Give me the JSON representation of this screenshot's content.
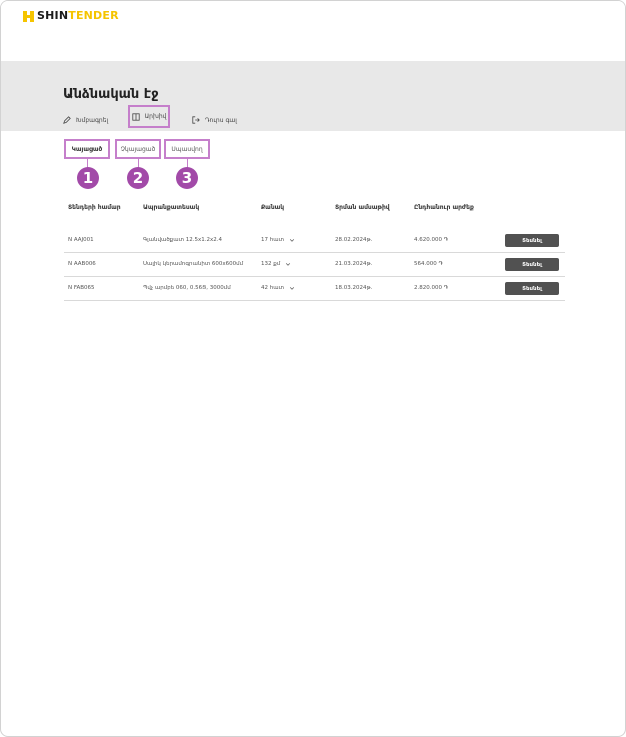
{
  "app": {
    "logo_part1": "SHIN",
    "logo_part2": "TENDER",
    "brand_color": "#f5c400"
  },
  "page": {
    "title": "Անձնական էջ"
  },
  "tabs": [
    {
      "label": "Խմբագրել",
      "icon": "pencil-icon"
    },
    {
      "label": "Արխիվ",
      "icon": "archive-icon"
    },
    {
      "label": "Դուրս գալ",
      "icon": "logout-icon"
    }
  ],
  "subtabs": [
    {
      "label": "Կայացած"
    },
    {
      "label": "Չկայացած"
    },
    {
      "label": "Սպասվող"
    }
  ],
  "markers": [
    "1",
    "2",
    "3"
  ],
  "table": {
    "headers": [
      "Տենդերի համար",
      "Ապրանքատեսակ",
      "Քանակ",
      "Տրման ամսաթիվ",
      "Ընդհանուր արժեք"
    ],
    "rows": [
      {
        "number": "N AAJ001",
        "product": "Գլանվածքատ 12.5x1.2x2.4",
        "quantity": "17 hատ",
        "date": "28.02.2024թ.",
        "total": "4.620.000 ֏",
        "button": "Տեսնել"
      },
      {
        "number": "N AAB006",
        "product": "Սալիկ կերամոգրանիտ 600x600մմ",
        "quantity": "132 քմ",
        "date": "21.03.2024թ.",
        "total": "564.000 ֏",
        "button": "Տեսնել"
      },
      {
        "number": "N FAB065",
        "product": "Պվչ արմբե 060, 0.56Ց, 3000մմ",
        "quantity": "42 hատ",
        "date": "18.03.2024թ.",
        "total": "2.820.000 ֏",
        "button": "Տեսնել"
      }
    ]
  },
  "colors": {
    "highlight": "#c57fcb",
    "marker": "#a24aa8",
    "button": "#515151",
    "header_band": "#e8e8e8"
  }
}
